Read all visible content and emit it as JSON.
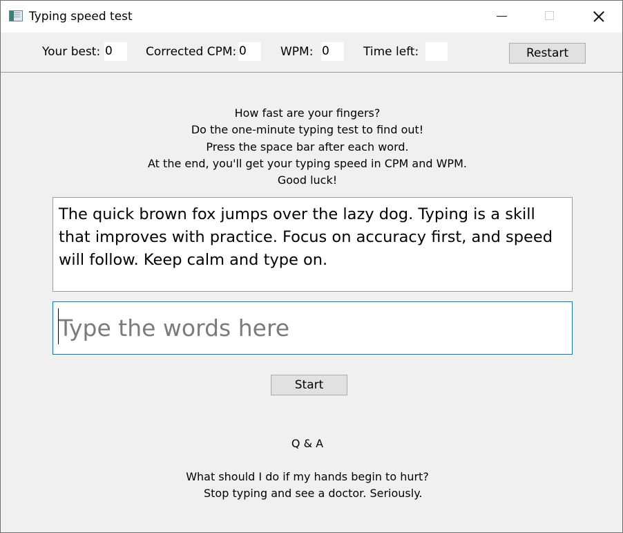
{
  "window": {
    "title": "Typing speed test",
    "icon": "app-window-icon",
    "controls": [
      "minimize-icon",
      "maximize-icon",
      "close-icon"
    ]
  },
  "stats": {
    "your_best_label": "Your best:",
    "your_best_value": "0",
    "corrected_cpm_label": "Corrected CPM:",
    "corrected_cpm_value": "0",
    "wpm_label": "WPM:",
    "wpm_value": "0",
    "time_left_label": "Time left:",
    "time_left_value": "",
    "restart_label": "Restart"
  },
  "instructions": [
    "How fast are your fingers?",
    "Do the one-minute typing test to find out!",
    "Press the space bar after each word.",
    "At the end, you'll get your typing speed in CPM and WPM.",
    "Good luck!"
  ],
  "sample_text": "The quick brown fox jumps over the lazy dog. Typing is a skill that improves with practice. Focus on accuracy first, and speed will follow. Keep calm and type on.",
  "typing_input": {
    "value": "",
    "placeholder": "Type the words here"
  },
  "start_label": "Start",
  "qa": {
    "heading": "Q & A",
    "question": "What should I do if my hands begin to hurt?",
    "answer": "Stop typing and see a doctor. Seriously."
  },
  "colors": {
    "window_background": "#f0f0f0",
    "input_border": "#0a78b4",
    "button_background": "#e1e1e1"
  }
}
